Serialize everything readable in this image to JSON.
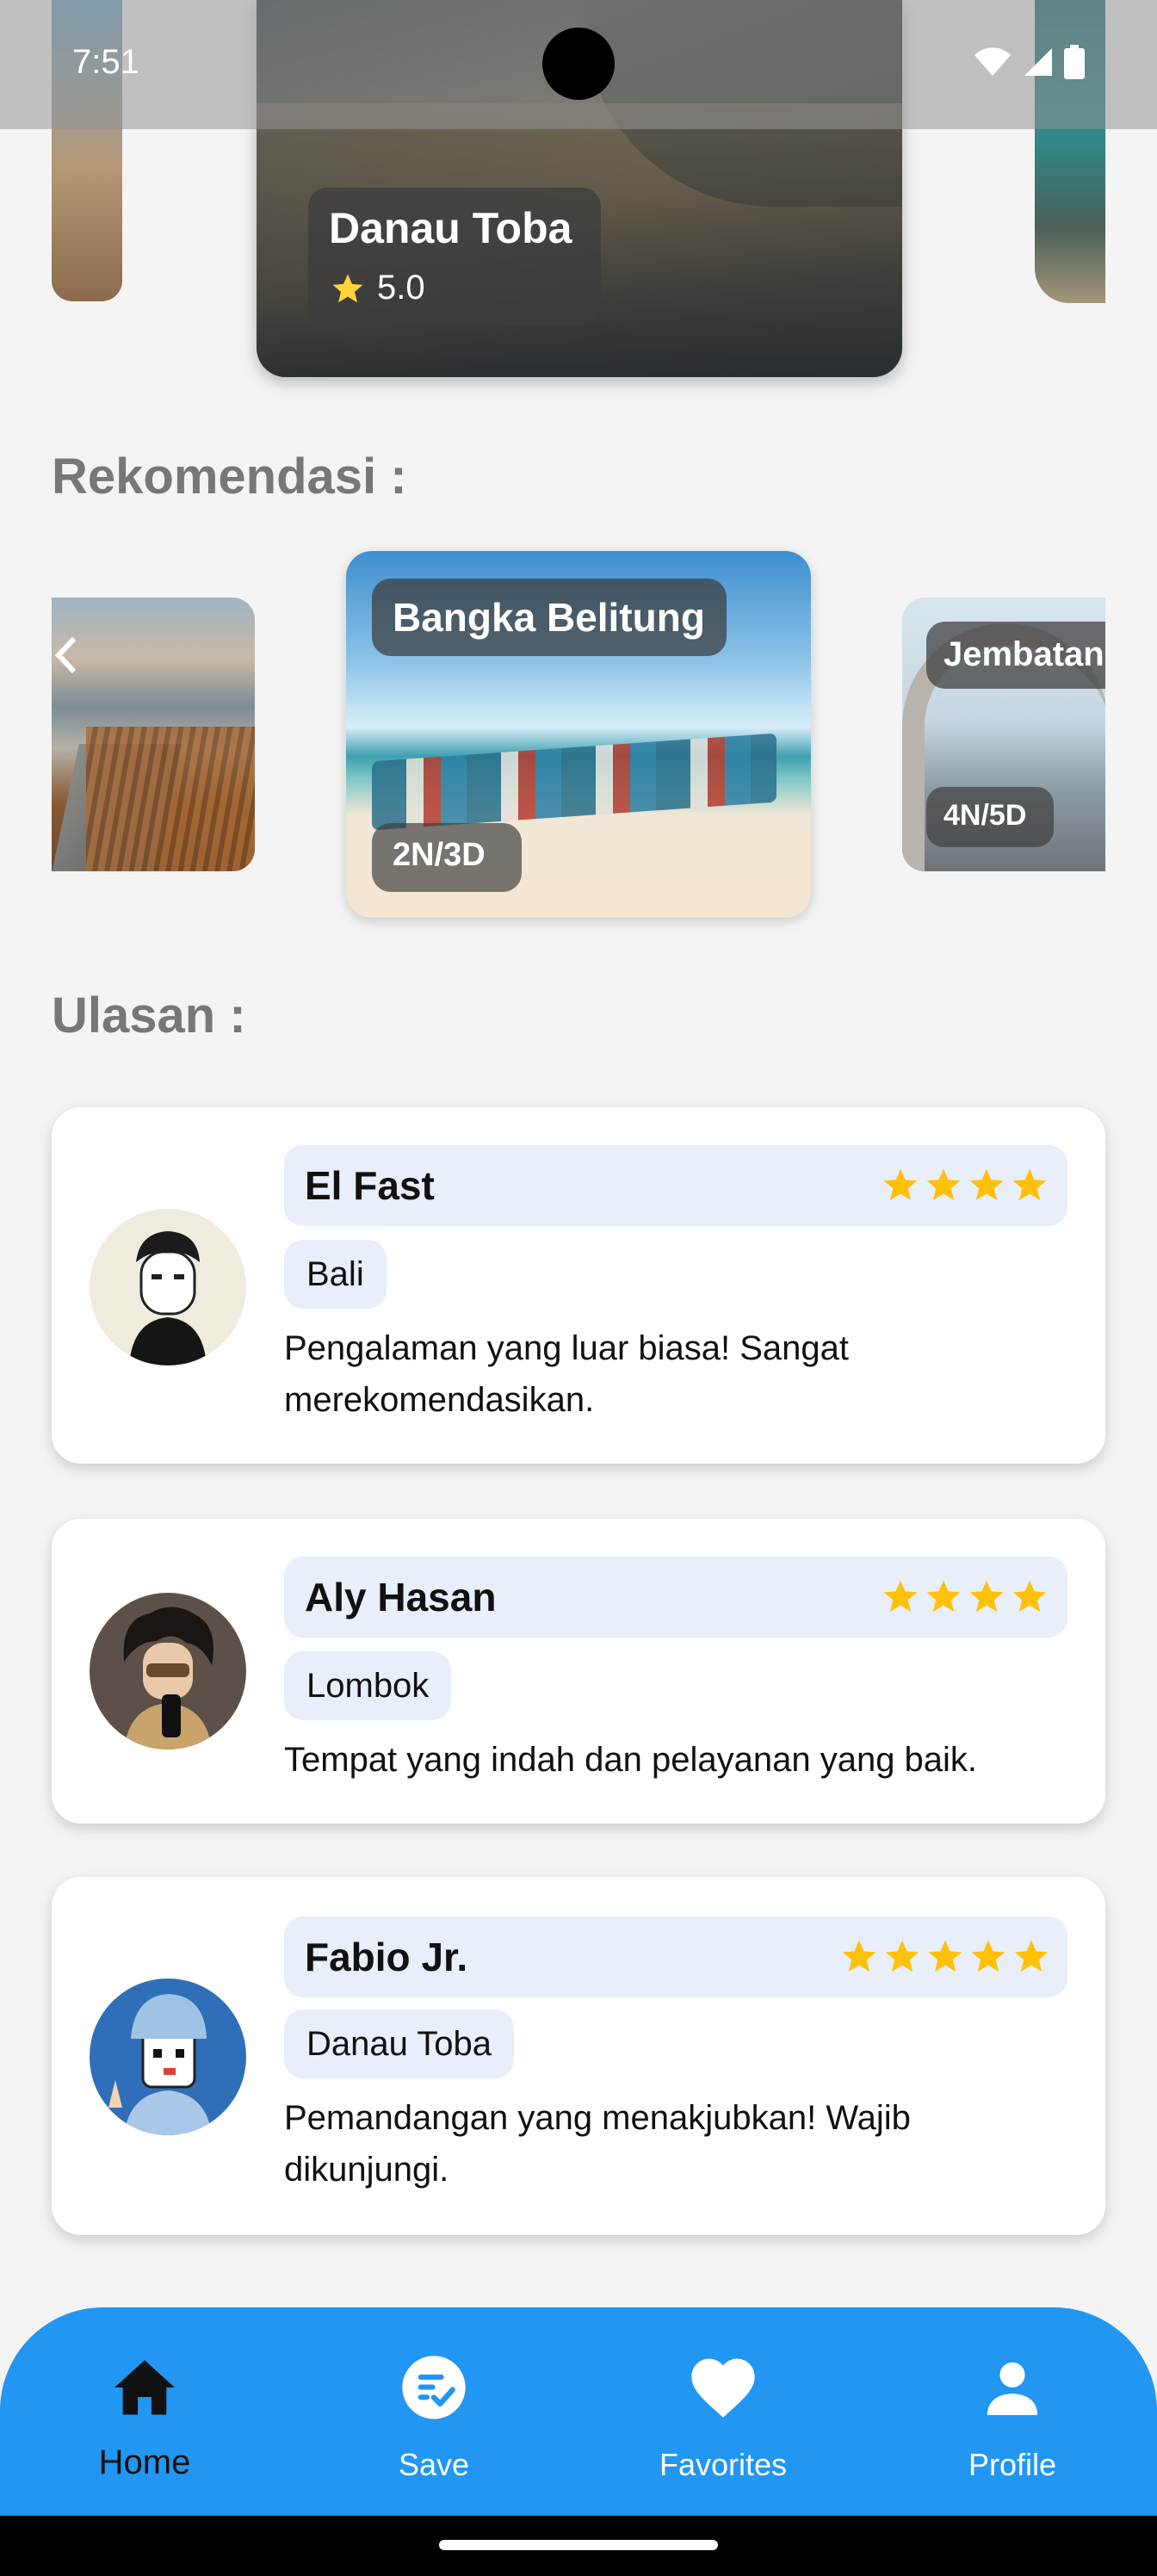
{
  "status_bar": {
    "time": "7:51"
  },
  "top_carousel": {
    "featured": {
      "title": "Danau Toba",
      "rating": "5.0"
    }
  },
  "sections": {
    "recommendations_title": "Rekomendasi :",
    "reviews_title": "Ulasan :"
  },
  "recommendations": {
    "center": {
      "title": "Bangka Belitung",
      "duration": "2N/3D"
    },
    "right": {
      "title": "Jembatan",
      "duration": "4N/5D"
    }
  },
  "reviews": [
    {
      "name": "El Fast",
      "stars": 4,
      "place": "Bali",
      "text": "Pengalaman yang luar biasa! Sangat merekomendasikan."
    },
    {
      "name": "Aly Hasan",
      "stars": 4,
      "place": "Lombok",
      "text": "Tempat yang indah dan pelayanan yang baik."
    },
    {
      "name": "Fabio Jr.",
      "stars": 5,
      "place": "Danau Toba",
      "text": "Pemandangan yang menakjubkan! Wajib dikunjungi."
    }
  ],
  "bottom_nav": {
    "items": [
      {
        "label": "Home",
        "icon": "home-icon",
        "active": true
      },
      {
        "label": "Save",
        "icon": "save-checklist-icon",
        "active": false
      },
      {
        "label": "Favorites",
        "icon": "heart-icon",
        "active": false
      },
      {
        "label": "Profile",
        "icon": "person-icon",
        "active": false
      }
    ]
  },
  "colors": {
    "accent": "#2196f3",
    "star": "#ffc107",
    "chip": "#e8eefa",
    "section_title": "#777777"
  }
}
